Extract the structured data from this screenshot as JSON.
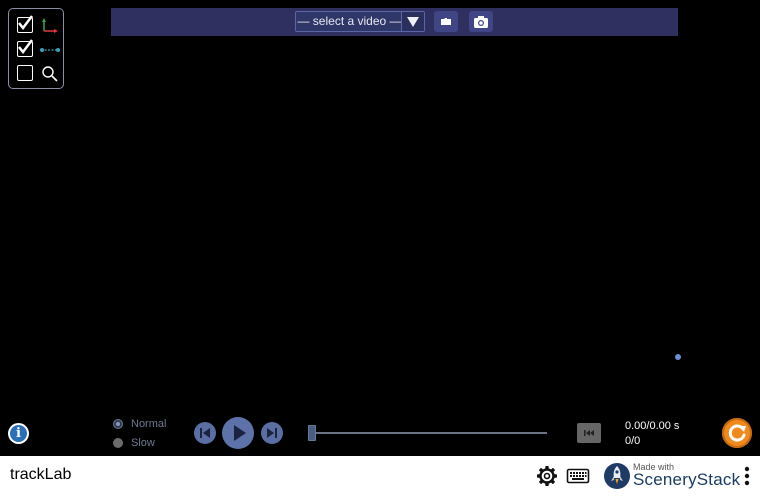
{
  "colors": {
    "background": "#000000",
    "toolbar": "#303060",
    "accent_orange": "#f08a1c",
    "nav_bar": "#ffffff"
  },
  "check_panel": {
    "items": [
      {
        "icon": "axes-icon",
        "checked": true
      },
      {
        "icon": "measuring-tape-icon",
        "checked": true
      },
      {
        "icon": "magnifier-icon",
        "checked": false
      }
    ]
  },
  "toolbar": {
    "video_select": {
      "value": "— select a video —",
      "icon": "chevron-down-icon"
    },
    "open_icon": "folder-icon",
    "snapshot_icon": "camera-icon"
  },
  "playback": {
    "speeds": [
      {
        "label": "Normal",
        "selected": true
      },
      {
        "label": "Slow",
        "selected": false
      }
    ],
    "time_readout": "0.00/0.00 s",
    "frame_readout": "0/0",
    "slider_position": 0
  },
  "nav_bar": {
    "title": "trackLab",
    "made_with": "Made with",
    "brand": "SceneryStack"
  }
}
